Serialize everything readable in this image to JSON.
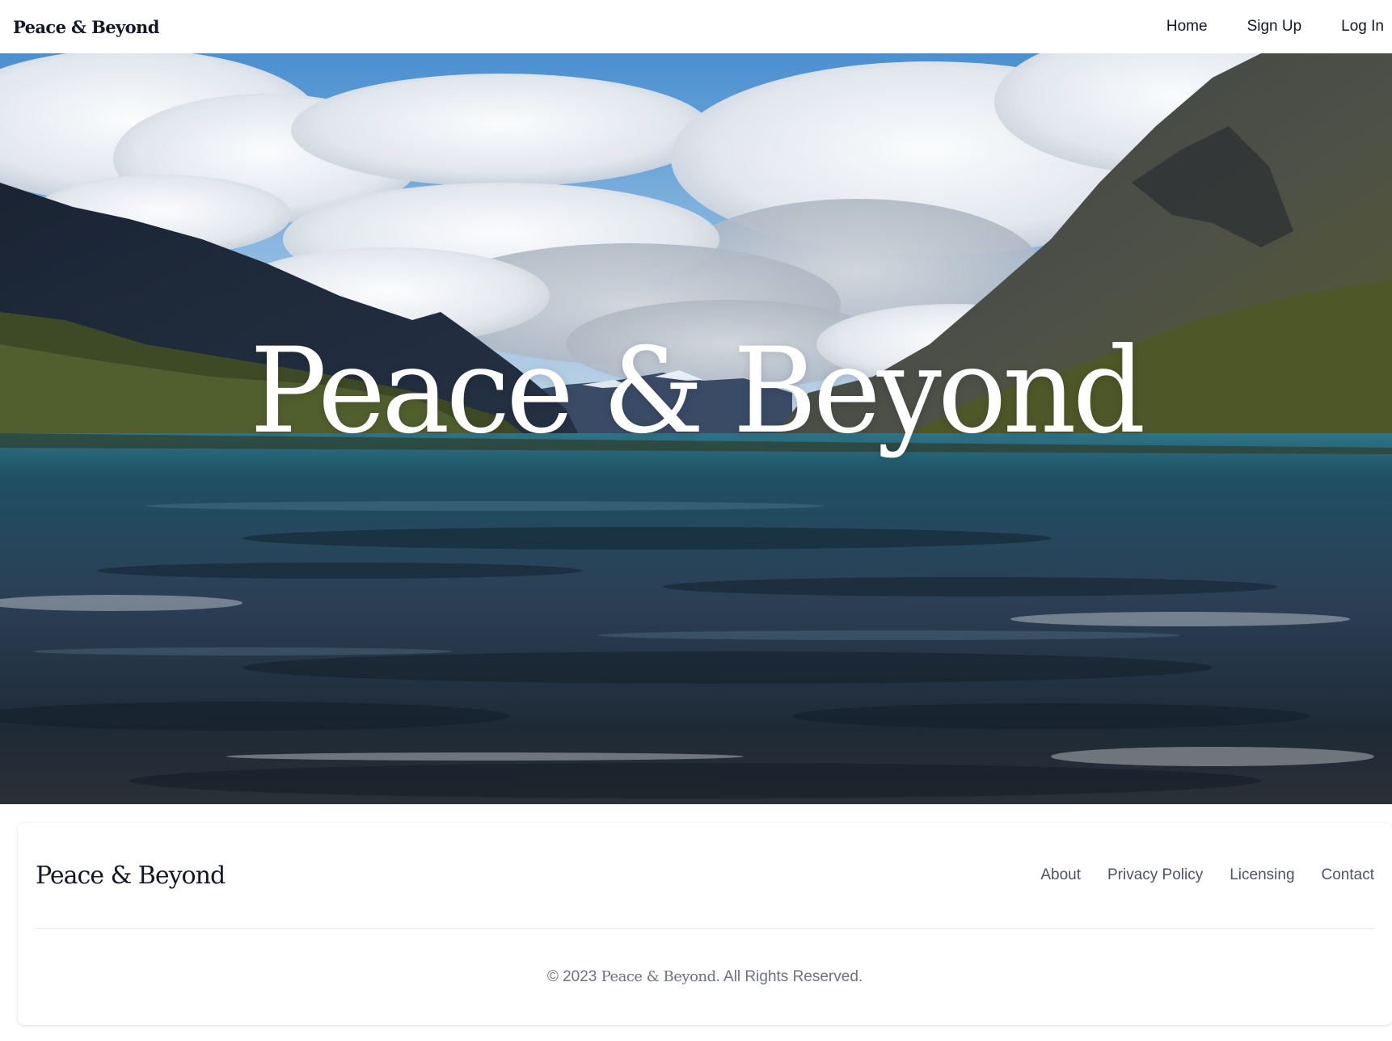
{
  "header": {
    "brand": "Peace & Beyond",
    "nav": [
      {
        "label": "Home"
      },
      {
        "label": "Sign Up"
      },
      {
        "label": "Log In"
      }
    ]
  },
  "hero": {
    "title": "Peace & Beyond",
    "image": "lake-mountains-clouds-landscape"
  },
  "footer": {
    "brand": "Peace & Beyond",
    "links": [
      {
        "label": "About"
      },
      {
        "label": "Privacy Policy"
      },
      {
        "label": "Licensing"
      },
      {
        "label": "Contact"
      }
    ],
    "copyright_prefix": "© 2023 ",
    "copyright_brand": "Peace & Beyond",
    "copyright_suffix": ". All Rights Reserved."
  },
  "colors": {
    "text_dark": "#111827",
    "text_muted": "#4b5563",
    "footer_copy": "#6b7280",
    "divider": "#e5e7eb"
  }
}
